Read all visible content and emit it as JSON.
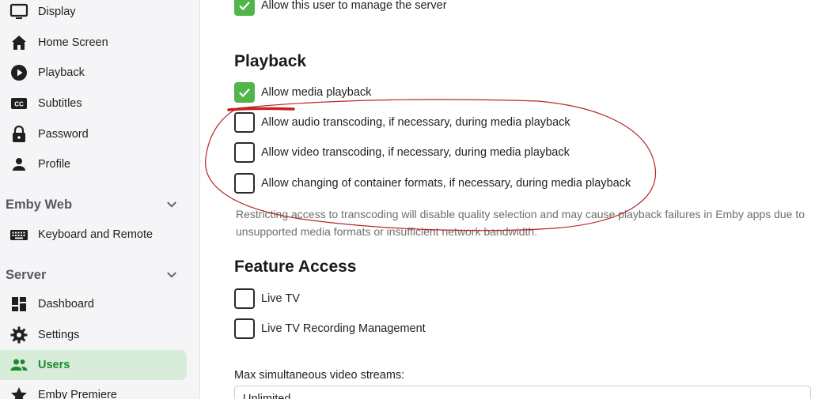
{
  "sidebar": {
    "items_top": [
      {
        "label": "Display",
        "icon": "monitor-icon"
      },
      {
        "label": "Home Screen",
        "icon": "home-icon"
      },
      {
        "label": "Playback",
        "icon": "play-circle-icon"
      },
      {
        "label": "Subtitles",
        "icon": "closed-captions-icon"
      },
      {
        "label": "Password",
        "icon": "lock-icon"
      },
      {
        "label": "Profile",
        "icon": "person-icon"
      }
    ],
    "section_emby_web": {
      "title": "Emby Web",
      "items": [
        {
          "label": "Keyboard and Remote",
          "icon": "keyboard-icon"
        }
      ]
    },
    "section_server": {
      "title": "Server",
      "items": [
        {
          "label": "Dashboard",
          "icon": "dashboard-icon"
        },
        {
          "label": "Settings",
          "icon": "gear-icon"
        },
        {
          "label": "Users",
          "icon": "people-icon",
          "active": true
        },
        {
          "label": "Emby Premiere",
          "icon": "star-icon"
        }
      ]
    }
  },
  "main": {
    "manage_server": {
      "label": "Allow this user to manage the server",
      "checked": true
    },
    "playback": {
      "title": "Playback",
      "options": [
        {
          "label": "Allow media playback",
          "checked": true
        },
        {
          "label": "Allow audio transcoding, if necessary, during media playback",
          "checked": false
        },
        {
          "label": "Allow video transcoding, if necessary, during media playback",
          "checked": false
        },
        {
          "label": "Allow changing of container formats, if necessary, during media playback",
          "checked": false
        }
      ],
      "help_text": "Restricting access to transcoding will disable quality selection and may cause playback failures in Emby apps due to unsupported media formats or insufficient network bandwidth."
    },
    "feature_access": {
      "title": "Feature Access",
      "options": [
        {
          "label": "Live TV",
          "checked": false
        },
        {
          "label": "Live TV Recording Management",
          "checked": false
        }
      ]
    },
    "max_streams": {
      "label": "Max simultaneous video streams:",
      "value": "Unlimited"
    }
  },
  "colors": {
    "accent_green": "#52b54b",
    "active_text_green": "#1b8a2f",
    "active_bg": "#d7ecd9",
    "annotation_red": "#cc1f1f"
  }
}
